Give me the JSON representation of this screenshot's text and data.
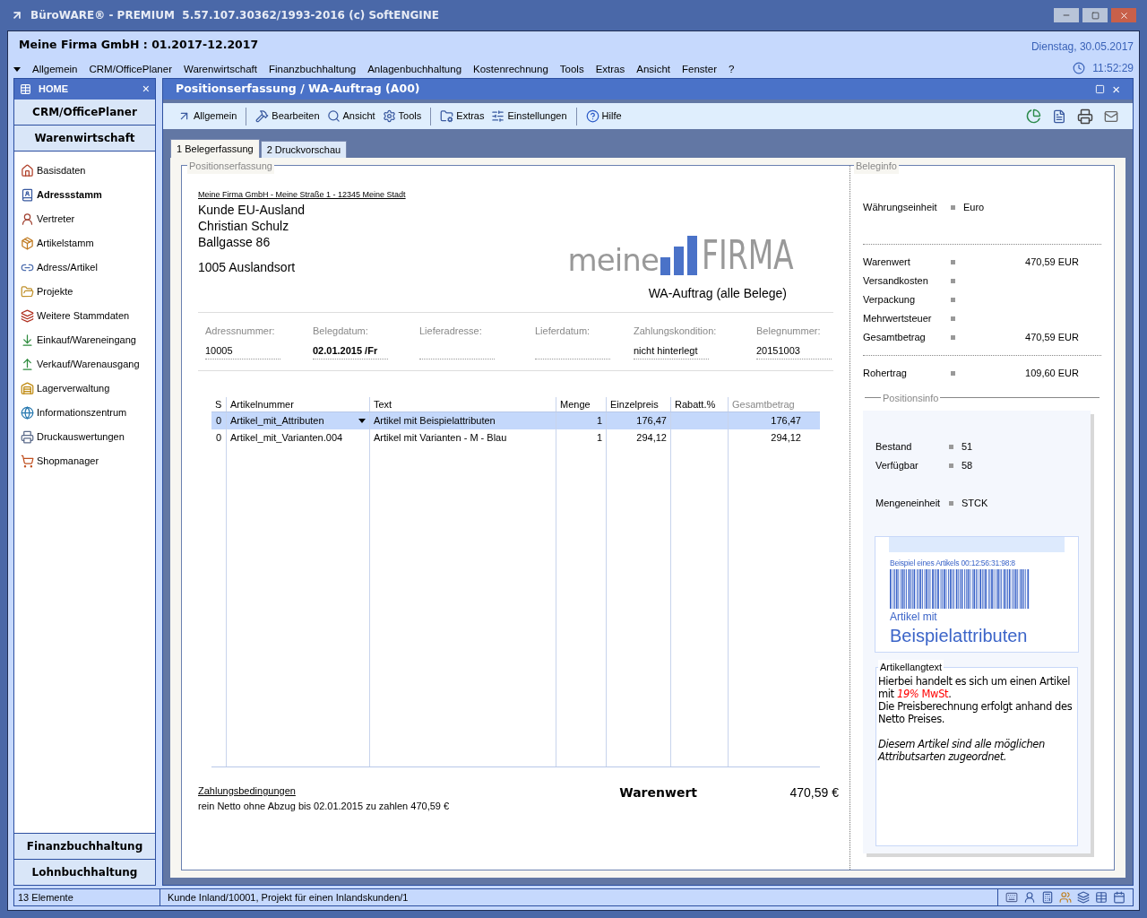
{
  "window": {
    "title": "BüroWARE® - PREMIUM  5.57.107.30362/1993-2016 (c) SoftENGINE"
  },
  "header": {
    "company": "Meine Firma GmbH : 01.2017-12.2017",
    "date": "Dienstag, 30.05.2017",
    "time": "11:52:29"
  },
  "menu": [
    "Allgemein",
    "CRM/OfficePlaner",
    "Warenwirtschaft",
    "Finanzbuchhaltung",
    "Anlagenbuchhaltung",
    "Kostenrechnung",
    "Tools",
    "Extras",
    "Ansicht",
    "Fenster",
    "?"
  ],
  "sidebar": {
    "title": "HOME",
    "close": "×",
    "top_sections": [
      "CRM/OfficePlaner",
      "Warenwirtschaft"
    ],
    "items": [
      {
        "label": "Basisdaten",
        "selected": false
      },
      {
        "label": "Adressstamm",
        "selected": true
      },
      {
        "label": "Vertreter",
        "selected": false
      },
      {
        "label": "Artikelstamm",
        "selected": false
      },
      {
        "label": "Adress/Artikel",
        "selected": false
      },
      {
        "label": "Projekte",
        "selected": false
      },
      {
        "label": "Weitere Stammdaten",
        "selected": false
      },
      {
        "label": "Einkauf/Wareneingang",
        "selected": false
      },
      {
        "label": "Verkauf/Warenausgang",
        "selected": false
      },
      {
        "label": "Lagerverwaltung",
        "selected": false
      },
      {
        "label": "Informationszentrum",
        "selected": false
      },
      {
        "label": "Druckauswertungen",
        "selected": false
      },
      {
        "label": "Shopmanager",
        "selected": false
      }
    ],
    "bottom_sections": [
      "Finanzbuchhaltung",
      "Lohnbuchhaltung"
    ]
  },
  "panel": {
    "title": "Positionserfassung / WA-Auftrag (A00)",
    "close": "×",
    "toolbar": [
      "Allgemein",
      "Bearbeiten",
      "Ansicht",
      "Tools",
      "Extras",
      "Einstellungen",
      "Hilfe"
    ],
    "tabs": [
      {
        "label": "1 Belegerfassung",
        "selected": true
      },
      {
        "label": "2 Druckvorschau",
        "selected": false
      }
    ]
  },
  "document": {
    "group_label": "Positionserfassung",
    "sender": "Meine Firma GmbH - Meine Straße 1 - 12345 Meine Stadt",
    "address": [
      "Kunde EU-Ausland",
      "Christian Schulz",
      "Ballgasse 86"
    ],
    "city": "1005 Auslandsort",
    "logo": {
      "left": "meine",
      "right": "FIRMA"
    },
    "doc_title": "WA-Auftrag (alle Belege)",
    "fields": [
      {
        "label": "Adressnummer:",
        "value": "10005",
        "bold": false
      },
      {
        "label": "Belegdatum:",
        "value": "02.01.2015 /Fr",
        "bold": true
      },
      {
        "label": "Lieferadresse:"
      },
      {
        "label": "Lieferdatum:"
      },
      {
        "label": "Zahlungskondition:",
        "value": "nicht hinterlegt",
        "bold": false
      },
      {
        "label": "Belegnummer:",
        "value": "20151003",
        "bold": false
      }
    ],
    "table": {
      "columns": [
        "S",
        "Artikelnummer",
        "Text",
        "Menge",
        "Einzelpreis",
        "Rabatt.%",
        "Gesamtbetrag"
      ],
      "rows": [
        {
          "selected": true,
          "cells": [
            "0",
            "Artikel_mit_Attributen",
            "Artikel mit Beispielattributen",
            "1",
            "176,47",
            "",
            "176,47"
          ]
        },
        {
          "selected": false,
          "cells": [
            "0",
            "Artikel_mit_Varianten.004",
            "Artikel mit Varianten - M - Blau",
            "1",
            "294,12",
            "",
            "294,12"
          ]
        }
      ]
    },
    "payment_link": "Zahlungsbedingungen",
    "payment_text": "rein Netto ohne Abzug bis 02.01.2015 zu zahlen 470,59 €",
    "total_label": "Warenwert",
    "total_value": "470,59 €"
  },
  "beleginfo": {
    "group_label": "Beleginfo",
    "currency": {
      "label": "Währungseinheit",
      "value": "Euro"
    },
    "amounts": [
      {
        "label": "Warenwert",
        "value": "470,59 EUR"
      },
      {
        "label": "Versandkosten"
      },
      {
        "label": "Verpackung"
      },
      {
        "label": "Mehrwertsteuer"
      },
      {
        "label": "Gesamtbetrag",
        "value": "470,59 EUR"
      }
    ],
    "profit": {
      "label": "Rohertrag",
      "value": "109,60 EUR"
    }
  },
  "positionsinfo": {
    "group_label": "Positionsinfo",
    "stock": [
      {
        "label": "Bestand",
        "value": "51"
      },
      {
        "label": "Verfügbar",
        "value": "58"
      }
    ],
    "unit": {
      "label": "Mengeneinheit",
      "value": "STCK"
    },
    "label_card": {
      "caption": "Beispiel eines Artikels 00:12:56:31:98:8",
      "line1": "Artikel mit",
      "line2": "Beispielattributen"
    },
    "longtext": {
      "title": "Artikellangtext",
      "paragraphs": [
        {
          "kind": "plain",
          "segments": [
            {
              "text": "Hierbei handelt es sich um einen Artikel mit ",
              "kind": "normal"
            },
            {
              "text": "19%",
              "kind": "highlight-italic"
            },
            {
              "text": " MwSt",
              "kind": "highlight"
            },
            {
              "text": ".",
              "kind": "normal"
            }
          ]
        },
        {
          "kind": "plain",
          "segments": [
            {
              "text": "Die Preisberechnung erfolgt anhand des Netto Preises.",
              "kind": "normal"
            }
          ]
        },
        {
          "kind": "italic",
          "segments": [
            {
              "text": "Diesem Artikel sind alle möglichen Attributsarten zugeordnet.",
              "kind": "normal"
            }
          ]
        }
      ]
    }
  },
  "status_bar": [
    "13 Elemente",
    "Kunde Inland/10001, Projekt für einen Inlandskunden/1"
  ]
}
